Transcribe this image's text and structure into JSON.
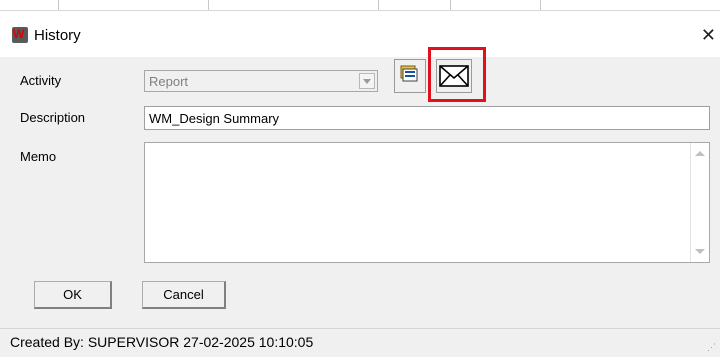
{
  "window": {
    "title": "History",
    "close_symbol": "✕"
  },
  "form": {
    "activity_label": "Activity",
    "activity_value": "Report",
    "description_label": "Description",
    "description_value": "WM_Design Summary",
    "memo_label": "Memo",
    "memo_value": ""
  },
  "buttons": {
    "ok": "OK",
    "cancel": "Cancel"
  },
  "toolbar": {
    "folder_icon": "folder-document-icon",
    "email_icon": "envelope-icon",
    "highlight_color": "#e0101c"
  },
  "status": {
    "created_by": "Created By: SUPERVISOR 27-02-2025 10:10:05"
  }
}
